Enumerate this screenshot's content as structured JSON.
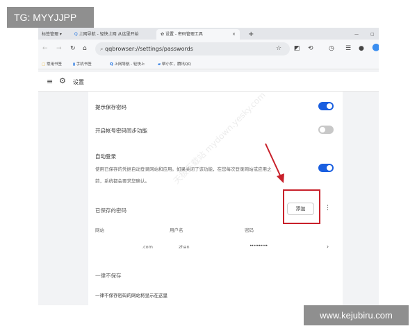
{
  "overlay_label": "TG: MYYJJPP",
  "watermark_site": "www.kejubiru.com",
  "watermark_diag": "天极下载站 mydown.yesky.com",
  "tabs": {
    "bookmark_manager": "标签管理 ▾",
    "tab1": "上网导航 - 轻快上网 从这里开始",
    "tab2": "设置 - 密码管理工具",
    "close": "×",
    "new": "+"
  },
  "address_bar": {
    "url": "qqbrowser://settings/passwords"
  },
  "bookmarks": [
    "常用书签",
    "手机书签",
    "上网导航 - 轻快上",
    "帮小忙，腾讯QQ"
  ],
  "header": {
    "title": "设置"
  },
  "settings": {
    "offer_save": {
      "label": "提示保存密码",
      "on": true
    },
    "sync": {
      "label": "开启帐号密码同步功能",
      "on": false
    },
    "auto_login": {
      "label": "自动登录",
      "desc1": "使用已保存的凭据自动登录网站和应用。如果关闭了该功能，在您每次登录网站或应用之",
      "desc2": "前，系统都会要求您确认。",
      "on": true
    }
  },
  "saved": {
    "title": "已保存的密码",
    "add": "添加",
    "columns": [
      "网站",
      "用户名",
      "密码"
    ],
    "rows": [
      {
        "site": ".com",
        "user": "zhan",
        "password": "••••••••••"
      }
    ]
  },
  "never_save": {
    "title": "一律不保存",
    "desc": "一律不保存密码的网站将显示在这里"
  },
  "colors": {
    "accent": "#1a5fe0",
    "annotation": "#c8202a"
  }
}
